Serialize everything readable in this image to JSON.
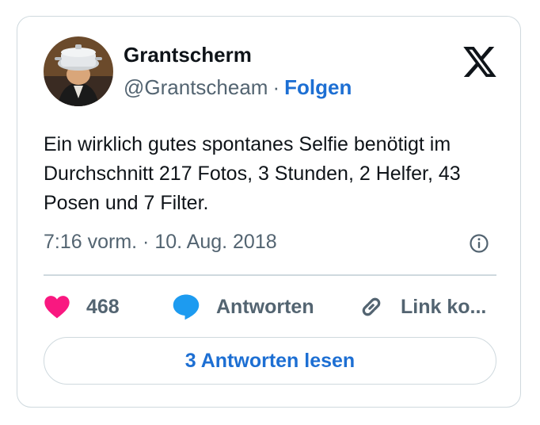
{
  "tweet": {
    "author": {
      "display_name": "Grantscherm",
      "handle": "@Grantscheam",
      "separator": "·",
      "follow_label": "Folgen",
      "avatar_icon": "avatar-portrait-with-pot"
    },
    "brand_icon": "x-logo-icon",
    "text": "Ein wirklich gutes spontanes Selfie benötigt im Durchschnitt 217 Fotos, 3 Stunden, 2 Helfer, 43 Posen und 7 Filter.",
    "timestamp": "7:16 vorm. · 10. Aug. 2018",
    "info_icon": "info-icon",
    "actions": {
      "like": {
        "icon": "heart-icon",
        "count": "468"
      },
      "reply": {
        "icon": "speech-bubble-icon",
        "label": "Antworten"
      },
      "copy_link": {
        "icon": "link-icon",
        "label": "Link ko..."
      }
    },
    "read_replies_label": "3 Antworten lesen"
  },
  "colors": {
    "accent": "#1d6fd3",
    "heart": "#f91880",
    "reply_icon": "#1d9bf0",
    "secondary_text": "#536471",
    "border": "#cfd9de"
  }
}
